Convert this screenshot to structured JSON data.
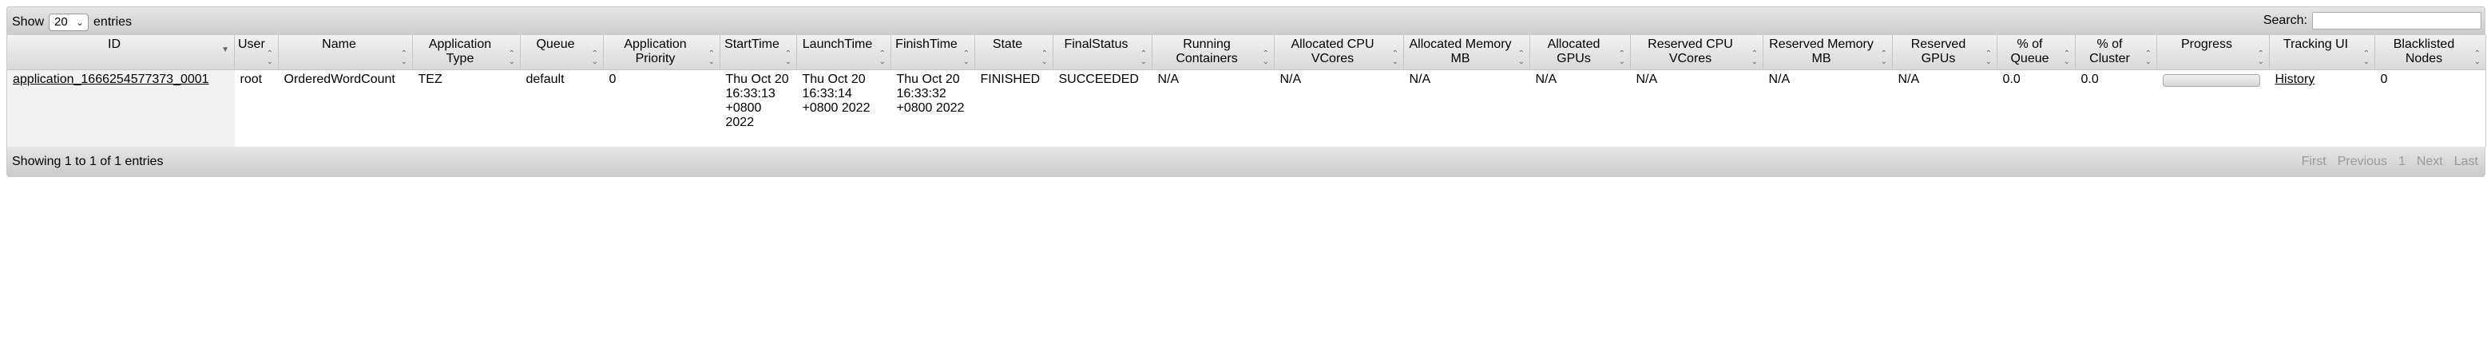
{
  "toolbar": {
    "show_label": "Show",
    "page_size": "20",
    "entries_label": "entries",
    "search_label": "Search:",
    "search_value": ""
  },
  "columns": [
    {
      "l1": "ID",
      "l2": "",
      "sort": "desc"
    },
    {
      "l1": "User",
      "l2": "",
      "sort": "both"
    },
    {
      "l1": "Name",
      "l2": "",
      "sort": "both"
    },
    {
      "l1": "Application",
      "l2": "Type",
      "sort": "both"
    },
    {
      "l1": "Queue",
      "l2": "",
      "sort": "both"
    },
    {
      "l1": "Application",
      "l2": "Priority",
      "sort": "both"
    },
    {
      "l1": "StartTime",
      "l2": "",
      "sort": "both"
    },
    {
      "l1": "LaunchTime",
      "l2": "",
      "sort": "both"
    },
    {
      "l1": "FinishTime",
      "l2": "",
      "sort": "both"
    },
    {
      "l1": "State",
      "l2": "",
      "sort": "both"
    },
    {
      "l1": "FinalStatus",
      "l2": "",
      "sort": "both"
    },
    {
      "l1": "Running",
      "l2": "Containers",
      "sort": "both"
    },
    {
      "l1": "Allocated CPU",
      "l2": "VCores",
      "sort": "both"
    },
    {
      "l1": "Allocated Memory",
      "l2": "MB",
      "sort": "both"
    },
    {
      "l1": "Allocated",
      "l2": "GPUs",
      "sort": "both"
    },
    {
      "l1": "Reserved CPU",
      "l2": "VCores",
      "sort": "both"
    },
    {
      "l1": "Reserved Memory",
      "l2": "MB",
      "sort": "both"
    },
    {
      "l1": "Reserved",
      "l2": "GPUs",
      "sort": "both"
    },
    {
      "l1": "% of",
      "l2": "Queue",
      "sort": "both"
    },
    {
      "l1": "% of",
      "l2": "Cluster",
      "sort": "both"
    },
    {
      "l1": "Progress",
      "l2": "",
      "sort": "both"
    },
    {
      "l1": "Tracking UI",
      "l2": "",
      "sort": "both"
    },
    {
      "l1": "Blacklisted",
      "l2": "Nodes",
      "sort": "both"
    }
  ],
  "rows": [
    {
      "id": "application_1666254577373_0001",
      "user": "root",
      "name": "OrderedWordCount",
      "app_type": "TEZ",
      "queue": "default",
      "priority": "0",
      "start_time": "Thu Oct 20 16:33:13 +0800 2022",
      "launch_time": "Thu Oct 20 16:33:14 +0800 2022",
      "finish_time": "Thu Oct 20 16:33:32 +0800 2022",
      "state": "FINISHED",
      "final_status": "SUCCEEDED",
      "running_containers": "N/A",
      "alloc_vcores": "N/A",
      "alloc_mem": "N/A",
      "alloc_gpus": "N/A",
      "res_vcores": "N/A",
      "res_mem": "N/A",
      "res_gpus": "N/A",
      "pct_queue": "0.0",
      "pct_cluster": "0.0",
      "progress": 0,
      "tracking_ui": "History",
      "blacklisted": "0"
    }
  ],
  "footer": {
    "info": "Showing 1 to 1 of 1 entries",
    "first": "First",
    "previous": "Previous",
    "page": "1",
    "next": "Next",
    "last": "Last"
  },
  "colors": {
    "header_gradient_top": "#f2f2f2",
    "header_gradient_bottom": "#d9d9d9",
    "sorted_column_bg": "#f2f2f2",
    "disabled_pager_text": "#9a9a9a"
  }
}
